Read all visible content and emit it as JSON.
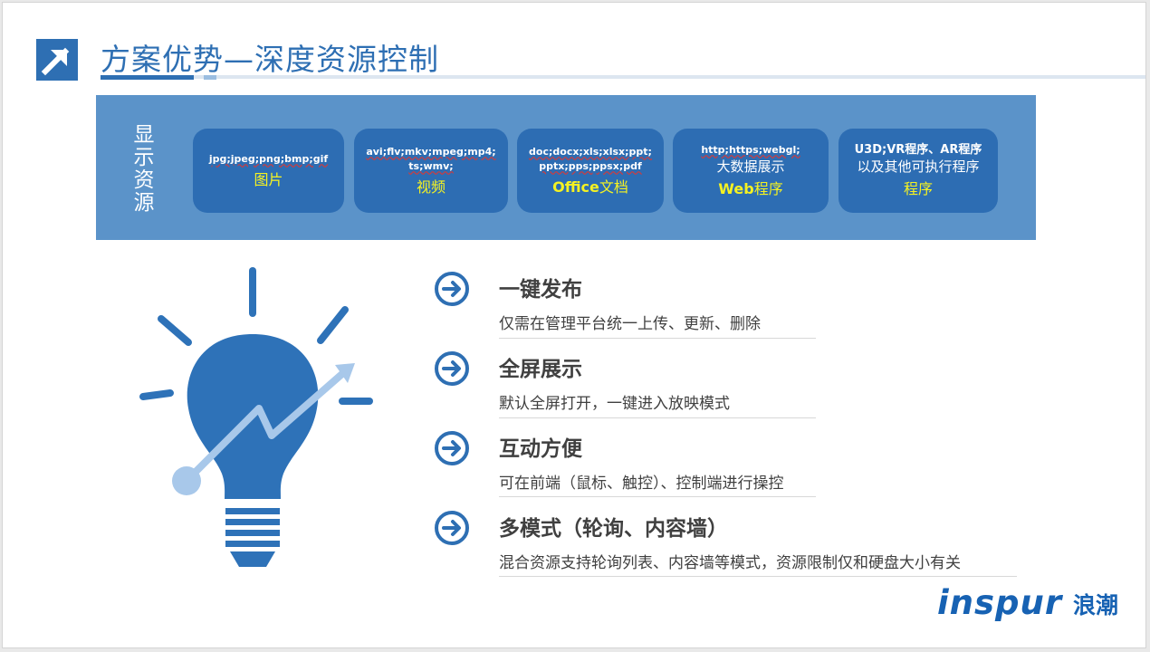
{
  "header": {
    "title": "方案优势—深度资源控制"
  },
  "resources": {
    "label": "显示资源",
    "cards": [
      {
        "formats": "jpg;jpeg;png;bmp;gif",
        "type": "图片"
      },
      {
        "formats": "avi;flv;mkv;mpeg;mp4; ts;wmv;",
        "type": "视频"
      },
      {
        "formats": "doc;docx;xls;xlsx;ppt; pptx;pps;ppsx;pdf",
        "type_bold": "Office",
        "type": "文档"
      },
      {
        "formats": "http;https;webgl;",
        "subtitle": "大数据展示",
        "type_bold": "Web",
        "type": "程序"
      },
      {
        "formats": "U3D;VR程序、AR程序",
        "subtitle": "以及其他可执行程序",
        "type": "程序"
      }
    ]
  },
  "features": [
    {
      "title": "一键发布",
      "desc": "仅需在管理平台统一上传、更新、删除"
    },
    {
      "title": "全屏展示",
      "desc": "默认全屏打开，一键进入放映模式"
    },
    {
      "title": "互动方便",
      "desc": "可在前端（鼠标、触控）、控制端进行操控"
    },
    {
      "title": "多模式（轮询、内容墙）",
      "desc": "混合资源支持轮询列表、内容墙等模式，资源限制仅和硬盘大小有关"
    }
  ],
  "logo": {
    "brand": "inspur",
    "brand_cn": "浪潮"
  },
  "colors": {
    "accent": "#2e6fb3",
    "band": "#5b93c9",
    "card": "#2d6db3",
    "highlight": "#f5f222",
    "bulb": "#2e72b8",
    "bulb_light": "#a8c8ea"
  }
}
